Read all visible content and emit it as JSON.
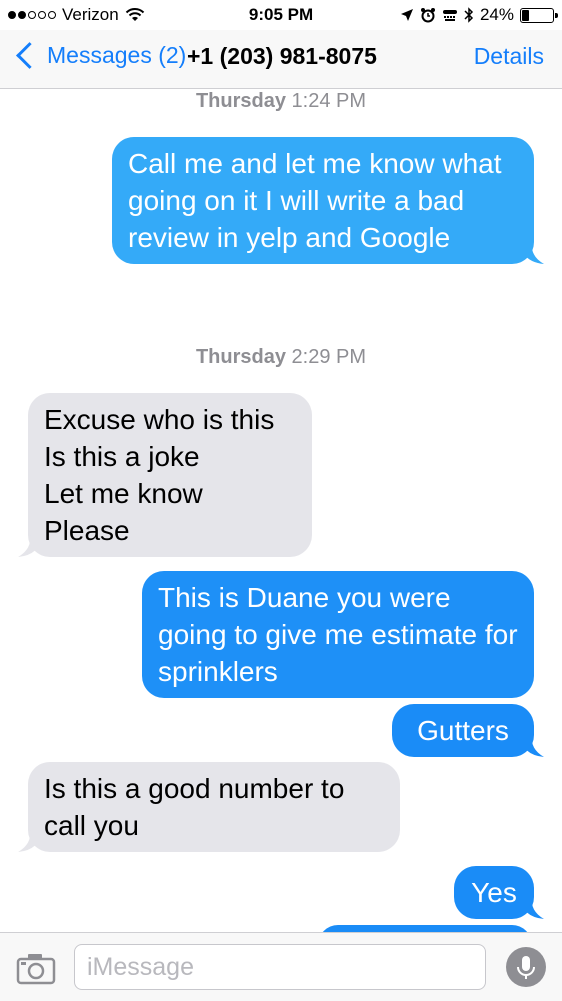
{
  "status_bar": {
    "carrier": "Verizon",
    "time": "9:05 PM",
    "battery_percent": "24%",
    "battery_level": 0.24,
    "signal_bars_filled": 2,
    "signal_bars_total": 5
  },
  "nav": {
    "back_label": "Messages (2)",
    "title": "+1 (203) 981-8075",
    "details_label": "Details"
  },
  "thread": {
    "timestamps": [
      {
        "day": "Thursday",
        "time": "1:24 PM"
      },
      {
        "day": "Thursday",
        "time": "2:29 PM"
      }
    ],
    "messages": [
      {
        "direction": "outgoing",
        "text": "Call me and let me know what going on it I will write a bad review in yelp and Google"
      },
      {
        "direction": "incoming",
        "text": "Excuse who is this\nIs this a joke\nLet me know\nPlease"
      },
      {
        "direction": "outgoing",
        "text": "This is Duane you were going to give me estimate for sprinklers"
      },
      {
        "direction": "outgoing",
        "text": "Gutters"
      },
      {
        "direction": "incoming",
        "text": "Is this a good number to call you"
      },
      {
        "direction": "outgoing",
        "text": "Yes"
      }
    ]
  },
  "input_bar": {
    "placeholder": "iMessage"
  },
  "icons": {
    "camera": "camera-icon",
    "mic": "microphone-icon",
    "back": "chevron-left-icon"
  },
  "colors": {
    "accent": "#147efb",
    "outgoing_bubble_light": "#34aaf8",
    "outgoing_bubble": "#1a8cf7",
    "incoming_bubble": "#e5e5ea",
    "timestamp": "#8e8e93"
  }
}
